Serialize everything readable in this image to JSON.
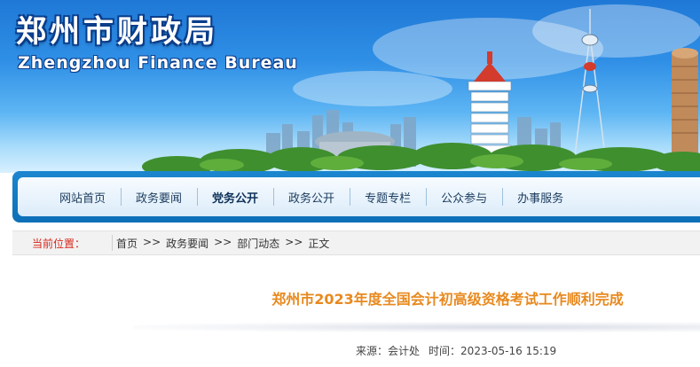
{
  "banner": {
    "title": "郑州市财政局",
    "subtitle": "Zhengzhou Finance Bureau"
  },
  "nav": {
    "items": [
      {
        "label": "网站首页"
      },
      {
        "label": "政务要闻"
      },
      {
        "label": "党务公开"
      },
      {
        "label": "政务公开"
      },
      {
        "label": "专题专栏"
      },
      {
        "label": "公众参与"
      },
      {
        "label": "办事服务"
      }
    ],
    "active_index": 2
  },
  "breadcrumb": {
    "label": "当前位置：",
    "items": [
      "首页",
      "政务要闻",
      "部门动态",
      "正文"
    ],
    "separator": ">>"
  },
  "article": {
    "title": "郑州市2023年度全国会计初高级资格考试工作顺利完成",
    "source_label": "来源：",
    "source": "会计处",
    "time_label": "时间：",
    "time": "2023-05-16 15:19"
  },
  "colors": {
    "nav_bar": "#0c6fb8",
    "title_orange": "#e8891e",
    "crumb_red": "#d7281c"
  }
}
